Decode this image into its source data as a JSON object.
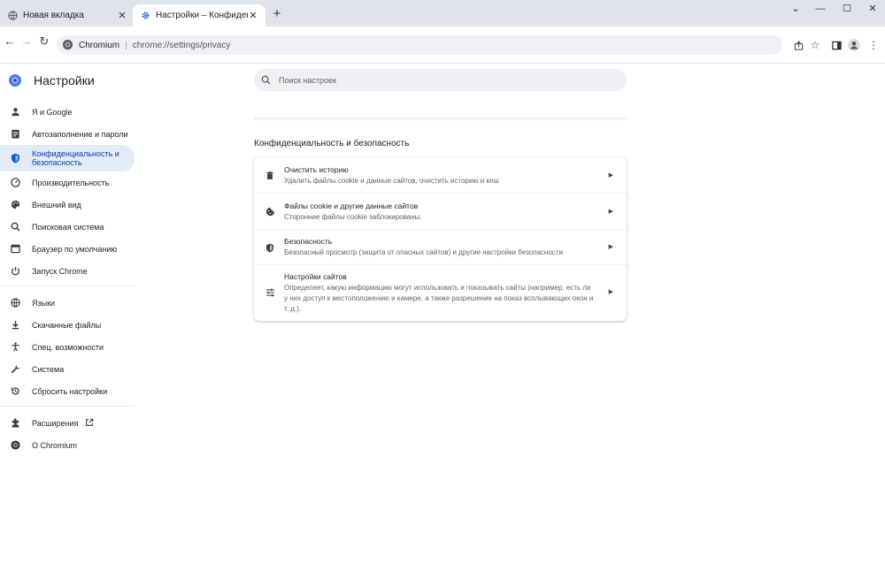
{
  "tabs": [
    {
      "label": "Новая вкладка",
      "icon": "globe-icon"
    },
    {
      "label": "Настройки – Конфиденциальн",
      "icon": "gear-icon"
    }
  ],
  "window": {
    "minimize": "⌄",
    "restore": "—",
    "maximize": "☐",
    "close": "✕"
  },
  "toolbar": {
    "site_name": "Chromium",
    "url": "chrome://settings/privacy"
  },
  "settings": {
    "title": "Настройки",
    "search_placeholder": "Поиск настроек"
  },
  "sidebar": {
    "items": [
      {
        "label": "Я и Google",
        "icon": "person-icon"
      },
      {
        "label": "Автозаполнение и пароли",
        "icon": "clipboard-icon"
      },
      {
        "label": "Конфиденциальность и безопасность",
        "icon": "shield-icon",
        "selected": true
      },
      {
        "label": "Производительность",
        "icon": "speedometer-icon"
      },
      {
        "label": "Внешний вид",
        "icon": "palette-icon"
      },
      {
        "label": "Поисковая система",
        "icon": "search-icon"
      },
      {
        "label": "Браузер по умолчанию",
        "icon": "browser-icon"
      },
      {
        "label": "Запуск Chrome",
        "icon": "power-icon"
      },
      {
        "label": "Языки",
        "icon": "globe-icon"
      },
      {
        "label": "Скачанные файлы",
        "icon": "download-icon"
      },
      {
        "label": "Спец. возможности",
        "icon": "accessibility-icon"
      },
      {
        "label": "Система",
        "icon": "wrench-icon"
      },
      {
        "label": "Сбросить настройки",
        "icon": "reset-icon"
      },
      {
        "label": "Расширения",
        "icon": "puzzle-icon"
      },
      {
        "label": "О Chromium",
        "icon": "chromium-icon"
      }
    ]
  },
  "privacy": {
    "section_title": "Конфиденциальность и безопасность",
    "rows": [
      {
        "title": "Очистить историю",
        "subtitle": "Удалить файлы cookie и данные сайтов, очистить историю и кеш",
        "icon": "trash-icon"
      },
      {
        "title": "Файлы cookie и другие данные сайтов",
        "subtitle": "Сторонние файлы cookie заблокированы.",
        "icon": "cookie-icon"
      },
      {
        "title": "Безопасность",
        "subtitle": "Безопасный просмотр (защита от опасных сайтов) и другие настройки безопасности",
        "icon": "shield-icon"
      },
      {
        "title": "Настройки сайтов",
        "subtitle": "Определяет, какую информацию могут использовать и показывать сайты (например, есть ли у них доступ к местоположению и камере, а также разрешение на показ всплывающих окон и т. д.).",
        "icon": "sliders-icon"
      }
    ]
  },
  "colors": {
    "accent": "#0b57d0",
    "selected_bg": "#e3ebf8",
    "titlebar_bg": "#dfe3eb"
  }
}
